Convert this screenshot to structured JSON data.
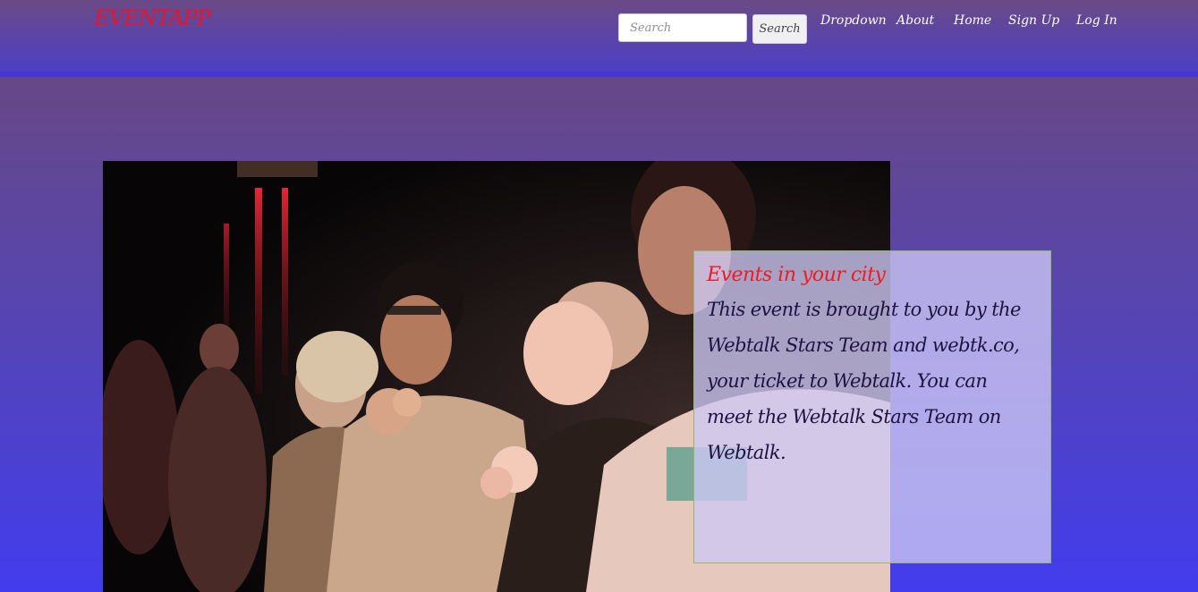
{
  "navbar": {
    "brand": "EVENTAPP",
    "search_placeholder": "Search",
    "search_button": "Search",
    "links": [
      "Dropdown",
      "About",
      "Home",
      "Sign Up",
      "Log In"
    ]
  },
  "hero": {
    "image_alt": "concert crowd photo",
    "card_title": "Events in your city",
    "card_text": "This event is brought to you by the Webtalk Stars Team and webtk.co, your ticket to Webtalk. You can meet the Webtalk Stars Team on Webtalk."
  },
  "colors": {
    "brand": "#e8142c",
    "card_title": "#f01a24",
    "card_text": "#1e1240",
    "nav_text": "#ffffff",
    "page_bottom": "#423cee"
  },
  "icons": {
    "photo": "crowd-photo"
  }
}
